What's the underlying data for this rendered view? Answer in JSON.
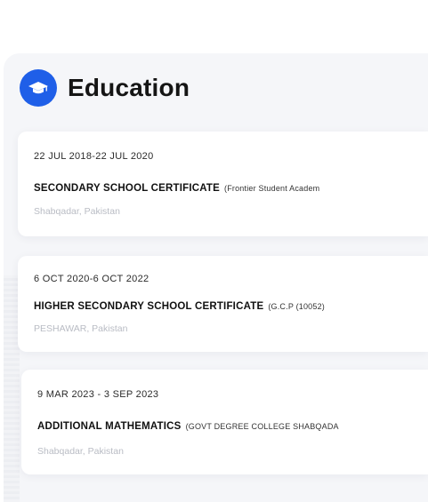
{
  "section": {
    "title": "Education",
    "icon": "graduation-cap-icon",
    "accent": "#1f5fe8"
  },
  "entries": [
    {
      "date": "22 JUL 2018-22 JUL 2020",
      "degree": "SECONDARY SCHOOL CERTIFICATE",
      "institution": "(Frontier Student Academ",
      "location": "Shabqadar, Pakistan"
    },
    {
      "date": "6 OCT 2020-6 OCT 2022",
      "degree": "HIGHER SECONDARY SCHOOL CERTIFICATE",
      "institution": "(G.C.P (10052)",
      "location": "PESHAWAR, Pakistan"
    },
    {
      "date": "9 MAR 2023 - 3 SEP 2023",
      "degree": "ADDITIONAL MATHEMATICS",
      "institution": "(GOVT DEGREE COLLEGE SHABQADA",
      "location": "Shabqadar, Pakistan"
    }
  ]
}
